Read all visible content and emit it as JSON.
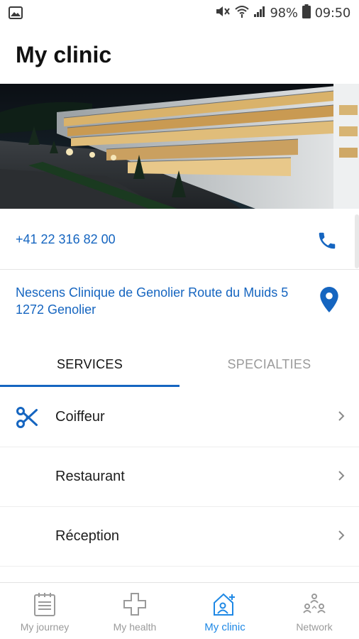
{
  "status_bar": {
    "battery_percent": "98%",
    "time": "09:50",
    "icons": [
      "image-icon",
      "mute-icon",
      "wifi-icon",
      "signal-icon",
      "battery-icon"
    ]
  },
  "header": {
    "title": "My clinic"
  },
  "contact": {
    "phone": "+41 22 316 82 00",
    "address": "Nescens Clinique de Genolier Route du Muids 5 1272 Genolier"
  },
  "tabs": [
    {
      "label": "SERVICES",
      "active": true
    },
    {
      "label": "SPECIALTIES",
      "active": false
    }
  ],
  "services": [
    {
      "label": "Coiffeur",
      "icon": "scissors-icon"
    },
    {
      "label": "Restaurant",
      "icon": ""
    },
    {
      "label": "Réception",
      "icon": ""
    }
  ],
  "bottom_nav": [
    {
      "label": "My journey",
      "icon": "clipboard-icon",
      "active": false
    },
    {
      "label": "My health",
      "icon": "medical-cross-icon",
      "active": false
    },
    {
      "label": "My clinic",
      "icon": "clinic-icon",
      "active": true
    },
    {
      "label": "Network",
      "icon": "network-icon",
      "active": false
    }
  ],
  "colors": {
    "accent": "#1565c0",
    "nav_active": "#1e88e5",
    "inactive_text": "#9a9a9a"
  }
}
